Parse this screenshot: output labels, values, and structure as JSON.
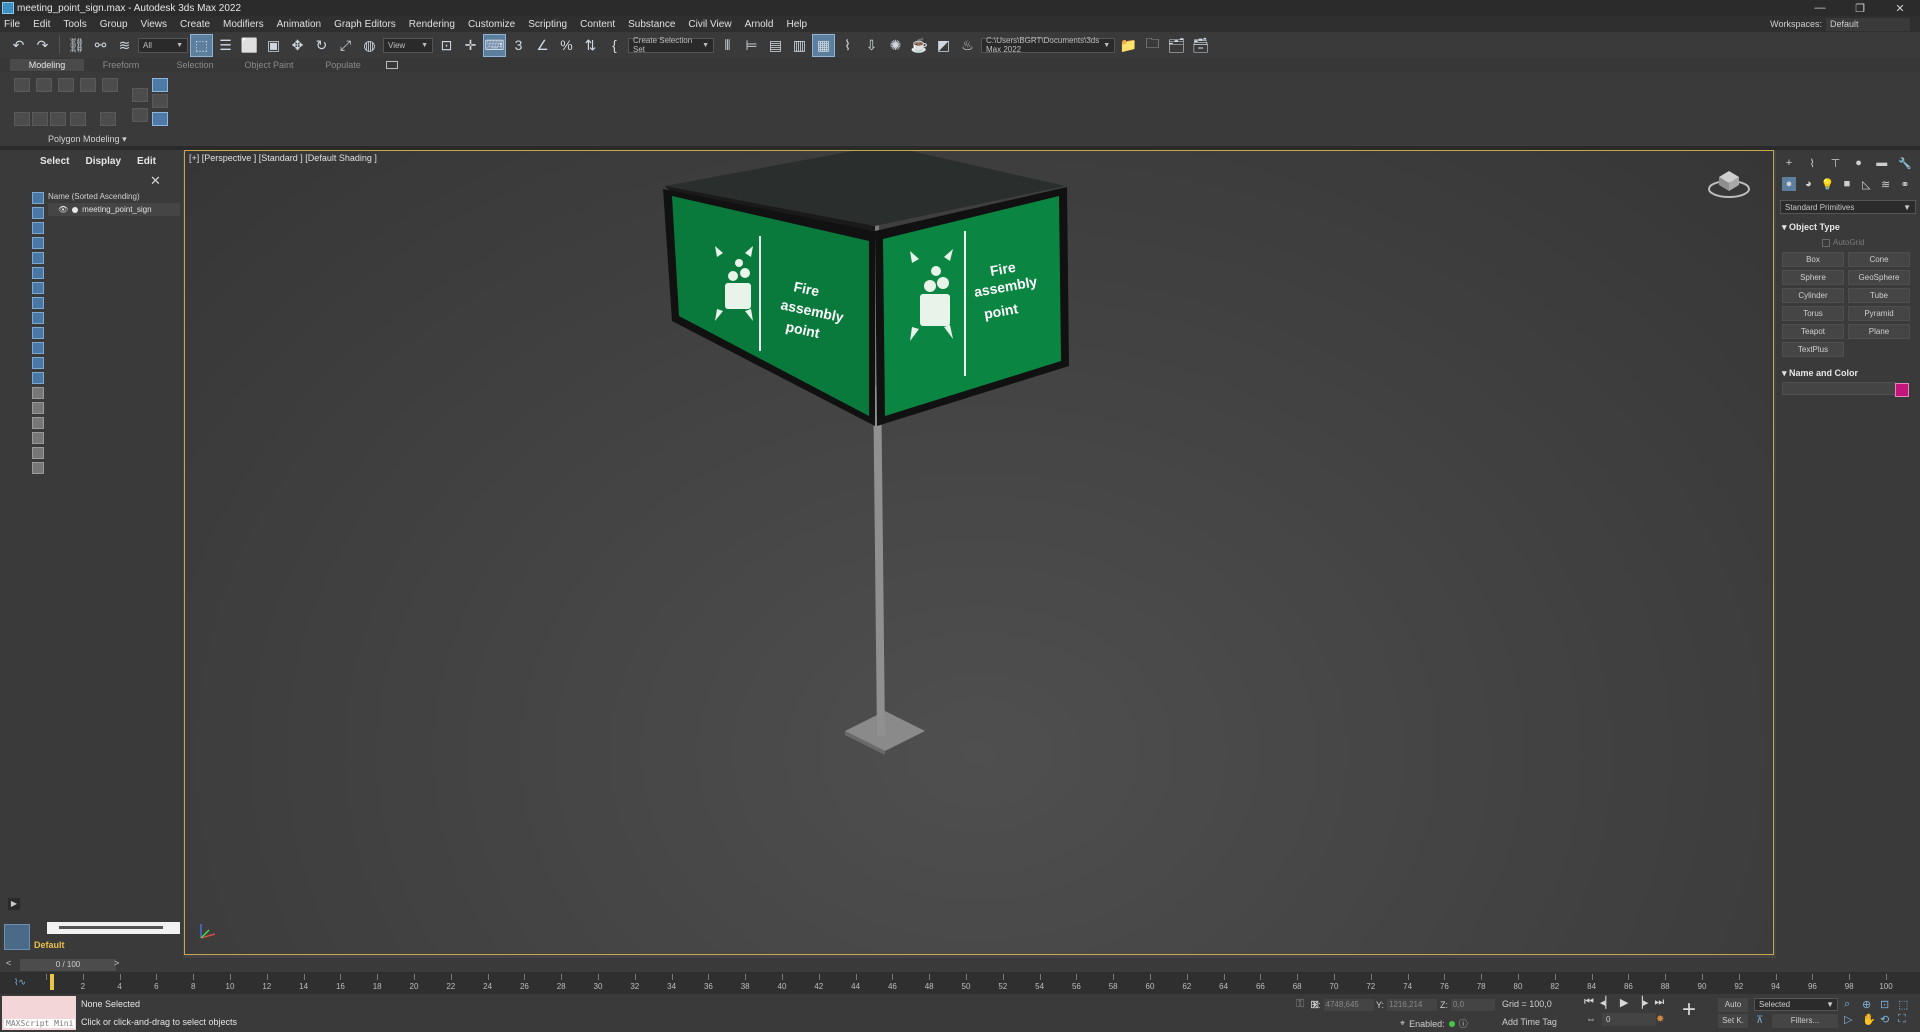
{
  "window": {
    "title": "meeting_point_sign.max - Autodesk 3ds Max 2022",
    "buttons": [
      "—",
      "❐",
      "✕"
    ]
  },
  "menu": [
    "File",
    "Edit",
    "Tools",
    "Group",
    "Views",
    "Create",
    "Modifiers",
    "Animation",
    "Graph Editors",
    "Rendering",
    "Customize",
    "Scripting",
    "Content",
    "Substance",
    "Civil View",
    "Arnold",
    "Help"
  ],
  "workspace": {
    "label": "Workspaces:",
    "value": "Default"
  },
  "toolbar": {
    "selection_filter": "All",
    "ref_coord": "View",
    "selection_set": "Create Selection Set",
    "project_path": "C:\\Users\\BGRT\\Documents\\3ds Max 2022"
  },
  "ribbon": {
    "tabs": [
      "Modeling",
      "Freeform",
      "Selection",
      "Object Paint",
      "Populate"
    ],
    "active_tab": "Modeling",
    "group_label": "Polygon Modeling"
  },
  "scene_explorer": {
    "tabs": [
      "Select",
      "Display",
      "Edit"
    ],
    "column_header": "Name (Sorted Ascending)",
    "objects": [
      "meeting_point_sign"
    ],
    "layer": "Default"
  },
  "viewport": {
    "label": "[+] [Perspective ] [Standard ] [Default Shading ]",
    "sign_text": [
      "Fire",
      "assembly",
      "point"
    ],
    "sign_color": "#0a7a3c"
  },
  "command_panel": {
    "category": "Standard Primitives",
    "object_type_title": "Object Type",
    "autogrid": "AutoGrid",
    "primitives": [
      "Box",
      "Cone",
      "Sphere",
      "GeoSphere",
      "Cylinder",
      "Tube",
      "Torus",
      "Pyramid",
      "Teapot",
      "Plane",
      "TextPlus"
    ],
    "name_color_title": "Name and Color",
    "object_color": "#c3157a"
  },
  "timeline": {
    "frame_display": "0 / 100",
    "ticks": [
      0,
      2,
      4,
      6,
      8,
      10,
      12,
      14,
      16,
      18,
      20,
      22,
      24,
      26,
      28,
      30,
      32,
      34,
      36,
      38,
      40,
      42,
      44,
      46,
      48,
      50,
      52,
      54,
      56,
      58,
      60,
      62,
      64,
      66,
      68,
      70,
      72,
      74,
      76,
      78,
      80,
      82,
      84,
      86,
      88,
      90,
      92,
      94,
      96,
      98,
      100
    ]
  },
  "status": {
    "maxscript": "MAXScript Mini",
    "selection": "None Selected",
    "prompt": "Click or click-and-drag to select objects",
    "x_label": "X:",
    "x_value": "4748,645",
    "y_label": "Y:",
    "y_value": "1216,214",
    "z_label": "Z:",
    "z_value": "0,0",
    "grid": "Grid = 100,0",
    "enabled": "Enabled:",
    "add_time_tag": "Add Time Tag",
    "auto_key": "Auto",
    "set_key": "Set K.",
    "key_filter": "Selected",
    "filters": "Filters...",
    "frame": "0"
  }
}
